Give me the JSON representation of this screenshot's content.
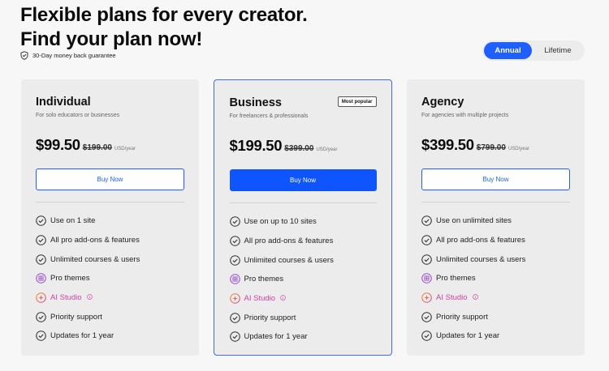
{
  "header": {
    "title_line1": "Flexible plans for every creator.",
    "title_line2": "Find your plan now!",
    "guarantee": "30-Day money back guarantee"
  },
  "billing_toggle": {
    "options": [
      "Annual",
      "Lifetime"
    ],
    "selected": "Annual"
  },
  "colors": {
    "accent": "#1f5eff",
    "card_bg": "#ececec",
    "highlight_border": "#3c6fe0",
    "ai_pink": "#d13fa0"
  },
  "plans": [
    {
      "name": "Individual",
      "description": "For solo educators or businesses",
      "price": "$99.50",
      "old_price": "$199.00",
      "unit": "USD/year",
      "button": "Buy Now",
      "features": [
        {
          "text": "Use on 1 site",
          "icon": "check-circle-icon"
        },
        {
          "text": "All pro add-ons & features",
          "icon": "check-circle-icon"
        },
        {
          "text": "Unlimited courses & users",
          "icon": "check-circle-icon"
        },
        {
          "text": "Pro themes",
          "icon": "theme-icon"
        },
        {
          "text": "AI Studio",
          "icon": "ai-studio-icon"
        },
        {
          "text": "Priority support",
          "icon": "check-circle-icon"
        },
        {
          "text": "Updates for 1 year",
          "icon": "check-circle-icon"
        }
      ]
    },
    {
      "name": "Business",
      "badge": "Most popular",
      "description": "For freelancers & professionals",
      "price": "$199.50",
      "old_price": "$399.00",
      "unit": "USD/year",
      "button": "Buy Now",
      "features": [
        {
          "text": "Use on up to 10 sites",
          "icon": "check-circle-icon"
        },
        {
          "text": "All pro add-ons & features",
          "icon": "check-circle-icon"
        },
        {
          "text": "Unlimited courses & users",
          "icon": "check-circle-icon"
        },
        {
          "text": "Pro themes",
          "icon": "theme-icon"
        },
        {
          "text": "AI Studio",
          "icon": "ai-studio-icon"
        },
        {
          "text": "Priority support",
          "icon": "check-circle-icon"
        },
        {
          "text": "Updates for 1 year",
          "icon": "check-circle-icon"
        }
      ]
    },
    {
      "name": "Agency",
      "description": "For agencies with multiple projects",
      "price": "$399.50",
      "old_price": "$799.00",
      "unit": "USD/year",
      "button": "Buy Now",
      "features": [
        {
          "text": "Use on unlimited sites",
          "icon": "check-circle-icon"
        },
        {
          "text": "All pro add-ons & features",
          "icon": "check-circle-icon"
        },
        {
          "text": "Unlimited courses & users",
          "icon": "check-circle-icon"
        },
        {
          "text": "Pro themes",
          "icon": "theme-icon"
        },
        {
          "text": "AI Studio",
          "icon": "ai-studio-icon"
        },
        {
          "text": "Priority support",
          "icon": "check-circle-icon"
        },
        {
          "text": "Updates for 1 year",
          "icon": "check-circle-icon"
        }
      ]
    }
  ]
}
